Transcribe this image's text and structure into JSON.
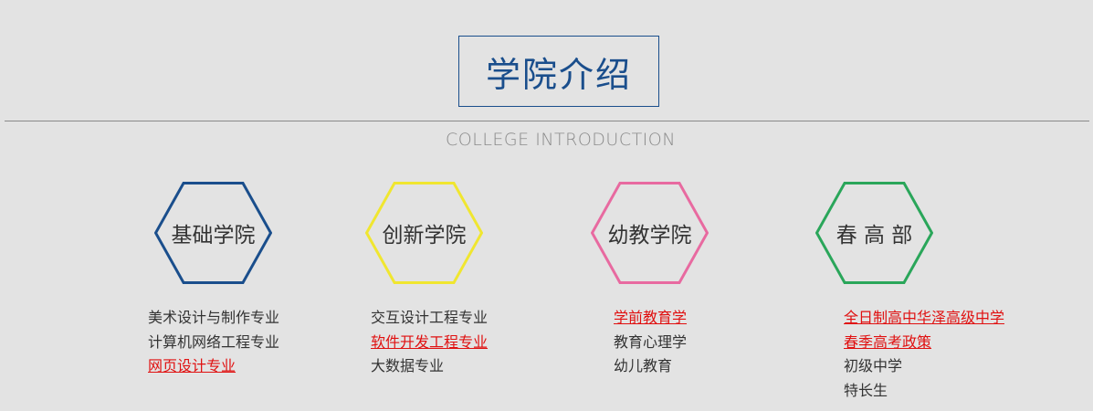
{
  "header": {
    "title": "学院介绍",
    "subtitle": "COLLEGE INTRODUCTION"
  },
  "colors": {
    "title": "#1a4e8c",
    "highlight_link": "#e01010",
    "hex_1": "#1a4e8c",
    "hex_2": "#f0e630",
    "hex_3": "#e86aa0",
    "hex_4": "#2aa65a"
  },
  "colleges": [
    {
      "name": "基础学院",
      "items": [
        {
          "label": "美术设计与制作专业"
        },
        {
          "label": "计算机网络工程专业"
        },
        {
          "label": "网页设计专业"
        }
      ]
    },
    {
      "name": "创新学院",
      "items": [
        {
          "label": "交互设计工程专业"
        },
        {
          "label": "软件开发工程专业"
        },
        {
          "label": "大数据专业"
        }
      ]
    },
    {
      "name": "幼教学院",
      "items": [
        {
          "label": "学前教育学"
        },
        {
          "label": "教育心理学"
        },
        {
          "label": "幼儿教育"
        }
      ]
    },
    {
      "name": "春 高 部",
      "items": [
        {
          "label": "全日制高中华泽高级中学"
        },
        {
          "label": "春季高考政策"
        },
        {
          "label": "初级中学"
        },
        {
          "label": "特长生"
        }
      ]
    }
  ]
}
